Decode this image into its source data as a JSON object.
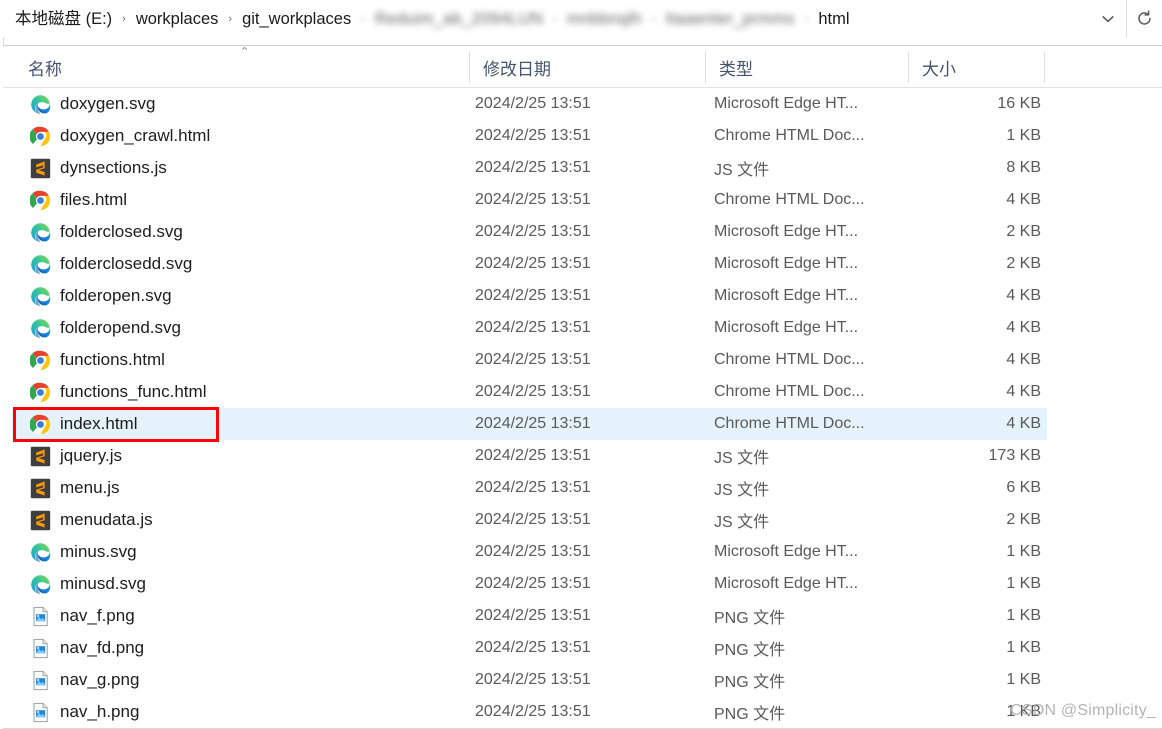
{
  "window": {
    "accent_selection": "#e5f2fb",
    "annotation_color": "#fb0606"
  },
  "addressbar": {
    "crumbs": [
      {
        "label": "本地磁盘 (E:)",
        "blurred": false
      },
      {
        "label": "workplaces",
        "blurred": false
      },
      {
        "label": "git_workplaces",
        "blurred": false
      },
      {
        "label": "Reduim_ab_2094LUN",
        "blurred": true
      },
      {
        "label": "mnbbnqlh",
        "blurred": true
      },
      {
        "label": "Itaaenter_prmms",
        "blurred": true
      },
      {
        "label": "html",
        "blurred": false
      }
    ],
    "separator": "›",
    "dropdown_icon": "chevron-down-icon",
    "refresh_icon": "refresh-icon"
  },
  "columns": {
    "name": "名称",
    "date": "修改日期",
    "type": "类型",
    "size": "大小",
    "sort_caret": "⌃",
    "sort_column": "name",
    "sort_direction": "ascending"
  },
  "files": [
    {
      "name": "doxygen.svg",
      "icon": "edge-icon",
      "date": "2024/2/25 13:51",
      "type": "Microsoft Edge HT...",
      "size": "16 KB",
      "selected": false
    },
    {
      "name": "doxygen_crawl.html",
      "icon": "chrome-icon",
      "date": "2024/2/25 13:51",
      "type": "Chrome HTML Doc...",
      "size": "1 KB",
      "selected": false
    },
    {
      "name": "dynsections.js",
      "icon": "sublime-icon",
      "date": "2024/2/25 13:51",
      "type": "JS 文件",
      "size": "8 KB",
      "selected": false
    },
    {
      "name": "files.html",
      "icon": "chrome-icon",
      "date": "2024/2/25 13:51",
      "type": "Chrome HTML Doc...",
      "size": "4 KB",
      "selected": false
    },
    {
      "name": "folderclosed.svg",
      "icon": "edge-icon",
      "date": "2024/2/25 13:51",
      "type": "Microsoft Edge HT...",
      "size": "2 KB",
      "selected": false
    },
    {
      "name": "folderclosedd.svg",
      "icon": "edge-icon",
      "date": "2024/2/25 13:51",
      "type": "Microsoft Edge HT...",
      "size": "2 KB",
      "selected": false
    },
    {
      "name": "folderopen.svg",
      "icon": "edge-icon",
      "date": "2024/2/25 13:51",
      "type": "Microsoft Edge HT...",
      "size": "4 KB",
      "selected": false
    },
    {
      "name": "folderopend.svg",
      "icon": "edge-icon",
      "date": "2024/2/25 13:51",
      "type": "Microsoft Edge HT...",
      "size": "4 KB",
      "selected": false
    },
    {
      "name": "functions.html",
      "icon": "chrome-icon",
      "date": "2024/2/25 13:51",
      "type": "Chrome HTML Doc...",
      "size": "4 KB",
      "selected": false
    },
    {
      "name": "functions_func.html",
      "icon": "chrome-icon",
      "date": "2024/2/25 13:51",
      "type": "Chrome HTML Doc...",
      "size": "4 KB",
      "selected": false
    },
    {
      "name": "index.html",
      "icon": "chrome-icon",
      "date": "2024/2/25 13:51",
      "type": "Chrome HTML Doc...",
      "size": "4 KB",
      "selected": true
    },
    {
      "name": "jquery.js",
      "icon": "sublime-icon",
      "date": "2024/2/25 13:51",
      "type": "JS 文件",
      "size": "173 KB",
      "selected": false
    },
    {
      "name": "menu.js",
      "icon": "sublime-icon",
      "date": "2024/2/25 13:51",
      "type": "JS 文件",
      "size": "6 KB",
      "selected": false
    },
    {
      "name": "menudata.js",
      "icon": "sublime-icon",
      "date": "2024/2/25 13:51",
      "type": "JS 文件",
      "size": "2 KB",
      "selected": false
    },
    {
      "name": "minus.svg",
      "icon": "edge-icon",
      "date": "2024/2/25 13:51",
      "type": "Microsoft Edge HT...",
      "size": "1 KB",
      "selected": false
    },
    {
      "name": "minusd.svg",
      "icon": "edge-icon",
      "date": "2024/2/25 13:51",
      "type": "Microsoft Edge HT...",
      "size": "1 KB",
      "selected": false
    },
    {
      "name": "nav_f.png",
      "icon": "png-icon",
      "date": "2024/2/25 13:51",
      "type": "PNG 文件",
      "size": "1 KB",
      "selected": false
    },
    {
      "name": "nav_fd.png",
      "icon": "png-icon",
      "date": "2024/2/25 13:51",
      "type": "PNG 文件",
      "size": "1 KB",
      "selected": false
    },
    {
      "name": "nav_g.png",
      "icon": "png-icon",
      "date": "2024/2/25 13:51",
      "type": "PNG 文件",
      "size": "1 KB",
      "selected": false
    },
    {
      "name": "nav_h.png",
      "icon": "png-icon",
      "date": "2024/2/25 13:51",
      "type": "PNG 文件",
      "size": "1 KB",
      "selected": false
    }
  ],
  "annotation": {
    "target_file": "index.html",
    "shape": "rectangle"
  },
  "watermark": {
    "text": "CSDN @Simplicity_"
  }
}
